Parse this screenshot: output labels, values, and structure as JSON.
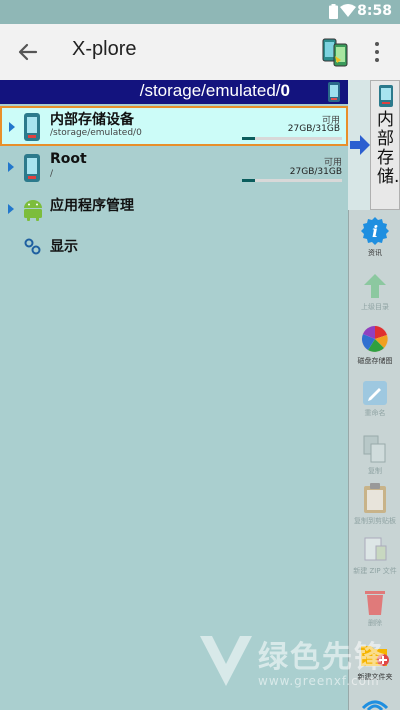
{
  "status_bar": {
    "time": "8:58"
  },
  "app_bar": {
    "title": "X-plore"
  },
  "left_pane": {
    "path_prefix": "/storage/emulated/",
    "path_last": "0",
    "items": [
      {
        "name": "内部存储设备",
        "sub": "/storage/emulated/0",
        "avail_label": "可用",
        "size": "27GB/31GB",
        "usage": 0.13
      },
      {
        "name": "Root",
        "sub": "/",
        "avail_label": "可用",
        "size": "27GB/31GB",
        "usage": 0.13
      },
      {
        "name": "应用程序管理"
      },
      {
        "name": "显示"
      }
    ]
  },
  "right_pane": {
    "tab_label": "内部存储...",
    "tools": [
      {
        "label": "资讯",
        "icon": "info-icon"
      },
      {
        "label": "上级目录",
        "icon": "up-arrow-icon"
      },
      {
        "label": "磁盘存储图",
        "icon": "disk-map-icon"
      },
      {
        "label": "重命名",
        "icon": "rename-icon"
      },
      {
        "label": "复制",
        "icon": "copy-icon"
      },
      {
        "label": "复制到剪贴板",
        "icon": "clipboard-icon"
      },
      {
        "label": "新建 ZIP 文件",
        "icon": "zip-icon"
      },
      {
        "label": "删除",
        "icon": "trash-icon"
      },
      {
        "label": "新建文件夹",
        "icon": "new-folder-icon"
      }
    ]
  },
  "watermark": {
    "text": "绿色先锋",
    "url": "www.greenxf.com"
  },
  "colors": {
    "path_bar": "#13137e",
    "selected_row": "#ccfcf8",
    "selection_border": "#e88f2a",
    "usage_bar": "#0b5d5d"
  }
}
